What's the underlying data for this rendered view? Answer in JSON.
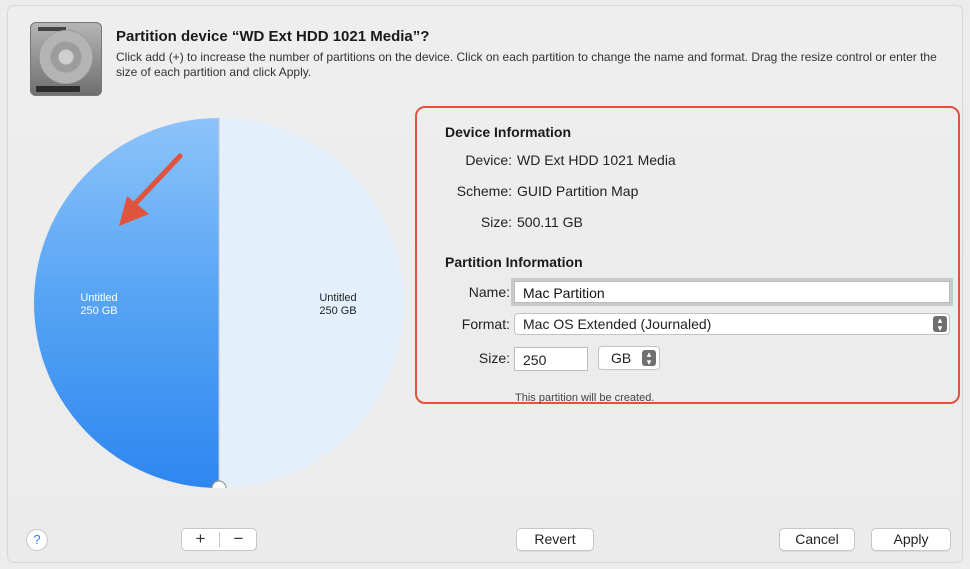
{
  "header": {
    "title": "Partition device “WD Ext HDD 1021 Media”?",
    "description": "Click add (+) to increase the number of partitions on the device. Click on each partition to change the name and format. Drag the resize control or enter the size of each partition and click Apply."
  },
  "pie": {
    "partitions": [
      {
        "name": "Untitled",
        "size": "250 GB",
        "selected": true,
        "fraction": 0.5
      },
      {
        "name": "Untitled",
        "size": "250 GB",
        "selected": false,
        "fraction": 0.5
      }
    ],
    "colors": {
      "selected": "#4593ee",
      "unselected": "#e3f0fc",
      "annotation": "#e0533d"
    }
  },
  "device_info": {
    "heading": "Device Information",
    "device_label": "Device:",
    "device_value": "WD Ext HDD 1021 Media",
    "scheme_label": "Scheme:",
    "scheme_value": "GUID Partition Map",
    "size_label": "Size:",
    "size_value": "500.11 GB"
  },
  "partition_info": {
    "heading": "Partition Information",
    "name_label": "Name:",
    "name_value": "Mac Partition",
    "format_label": "Format:",
    "format_value": "Mac OS Extended (Journaled)",
    "size_label": "Size:",
    "size_value": "250",
    "unit_value": "GB",
    "note": "This partition will be created."
  },
  "buttons": {
    "help": "?",
    "add": "+",
    "remove": "−",
    "revert": "Revert",
    "cancel": "Cancel",
    "apply": "Apply"
  },
  "icons": {
    "disk": "external-hard-drive-icon",
    "help": "question-icon",
    "stepper": "up-down-chevron-icon",
    "annotation_arrow": "red-arrow-icon"
  }
}
